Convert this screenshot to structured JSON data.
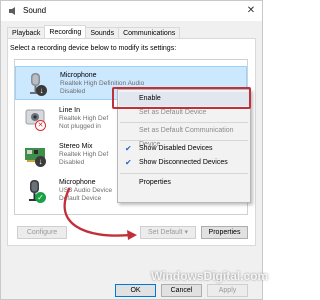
{
  "window": {
    "title": "Sound",
    "icon": "speaker-icon",
    "close_label": "✕"
  },
  "tabs": [
    {
      "label": "Playback",
      "active": false
    },
    {
      "label": "Recording",
      "active": true
    },
    {
      "label": "Sounds",
      "active": false
    },
    {
      "label": "Communications",
      "active": false
    }
  ],
  "instructions": "Select a recording device below to modify its settings:",
  "devices": [
    {
      "name": "Microphone",
      "driver": "Realtek High Definition Audio",
      "status": "Disabled",
      "icon": "microphone-icon",
      "badge": "down-arrow",
      "selected": true
    },
    {
      "name": "Line In",
      "driver": "Realtek High Def",
      "status": "Not plugged in",
      "icon": "line-in-icon",
      "badge": "not-plugged",
      "selected": false
    },
    {
      "name": "Stereo Mix",
      "driver": "Realtek High Def",
      "status": "Disabled",
      "icon": "sound-card-icon",
      "badge": "down-arrow",
      "selected": false
    },
    {
      "name": "Microphone",
      "driver": "USB Audio Device",
      "status": "Default Device",
      "icon": "microphone-icon",
      "badge": "check",
      "selected": false
    }
  ],
  "context_menu": {
    "items": [
      {
        "label": "Enable",
        "enabled": true,
        "checked": false,
        "highlighted": true
      },
      {
        "label": "Set as Default Device",
        "enabled": false,
        "checked": false,
        "highlighted": false
      },
      {
        "label": "Set as Default Communication Device",
        "enabled": false,
        "checked": false,
        "highlighted": false
      },
      {
        "label": "Show Disabled Devices",
        "enabled": true,
        "checked": true,
        "highlighted": false
      },
      {
        "label": "Show Disconnected Devices",
        "enabled": true,
        "checked": true,
        "highlighted": false
      },
      {
        "label": "Properties",
        "enabled": true,
        "checked": false,
        "highlighted": false
      }
    ]
  },
  "buttons": {
    "configure": "Configure",
    "set_default": "Set Default",
    "set_default_dropdown": "▾",
    "properties": "Properties",
    "ok": "OK",
    "cancel": "Cancel",
    "apply": "Apply"
  },
  "watermark": "WindowsDigital.com",
  "colors": {
    "selection": "#cce8ff",
    "highlight_box": "#c0303a",
    "arrow": "#c0303a",
    "check_badge": "#1aa146"
  }
}
